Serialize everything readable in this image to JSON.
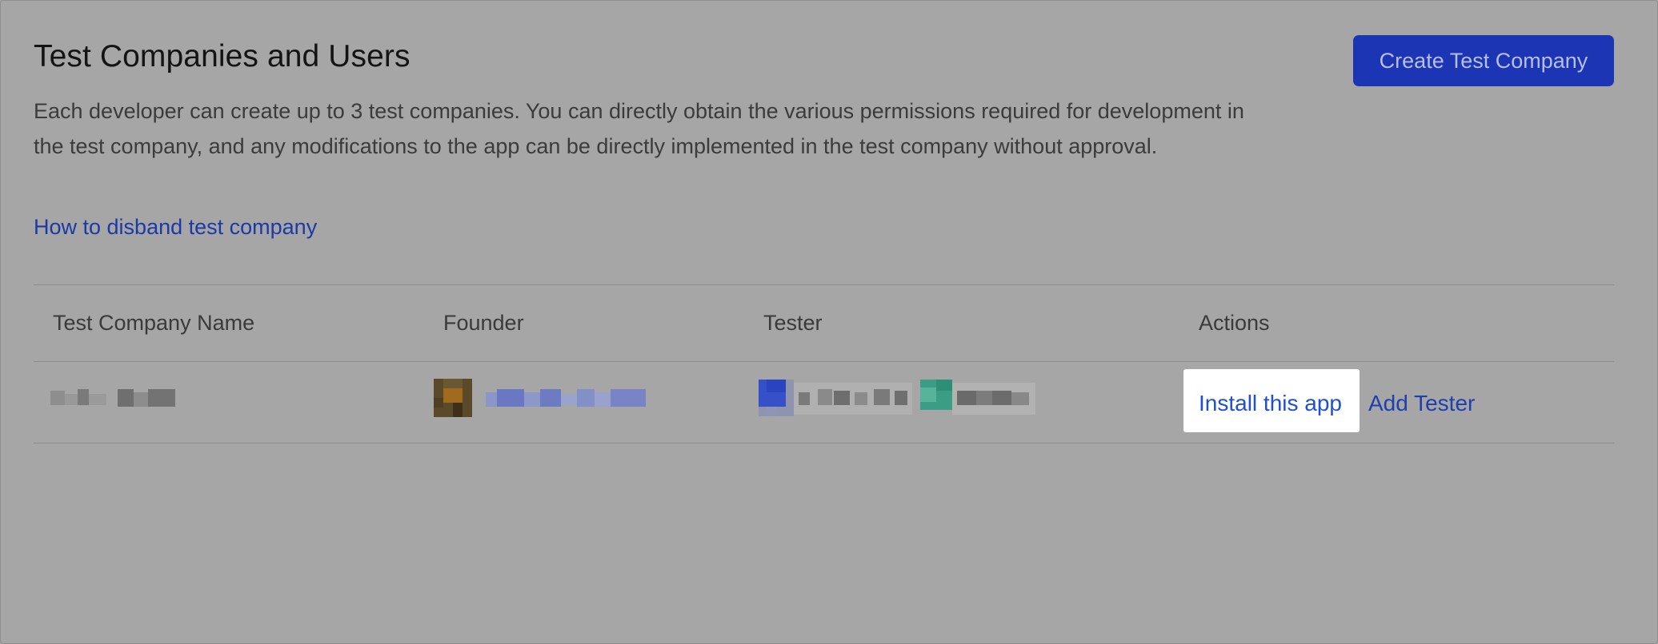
{
  "section": {
    "title": "Test Companies and Users",
    "create_button": "Create Test Company",
    "description": "Each developer can create up to 3 test companies. You can directly obtain the various permissions required for development in the test company, and any modifications to the app can be directly implemented in the test company without approval.",
    "help_link": "How to disband test company"
  },
  "table": {
    "headers": [
      "Test Company Name",
      "Founder",
      "Tester",
      "Actions"
    ],
    "rows": [
      {
        "actions": [
          "Install this app",
          "Add Tester"
        ]
      }
    ]
  },
  "colors": {
    "overlay_bg": "#a6a6a6",
    "primary_button": "#1b35b5",
    "link": "#1f4fd8",
    "highlight": "#ffffff"
  }
}
